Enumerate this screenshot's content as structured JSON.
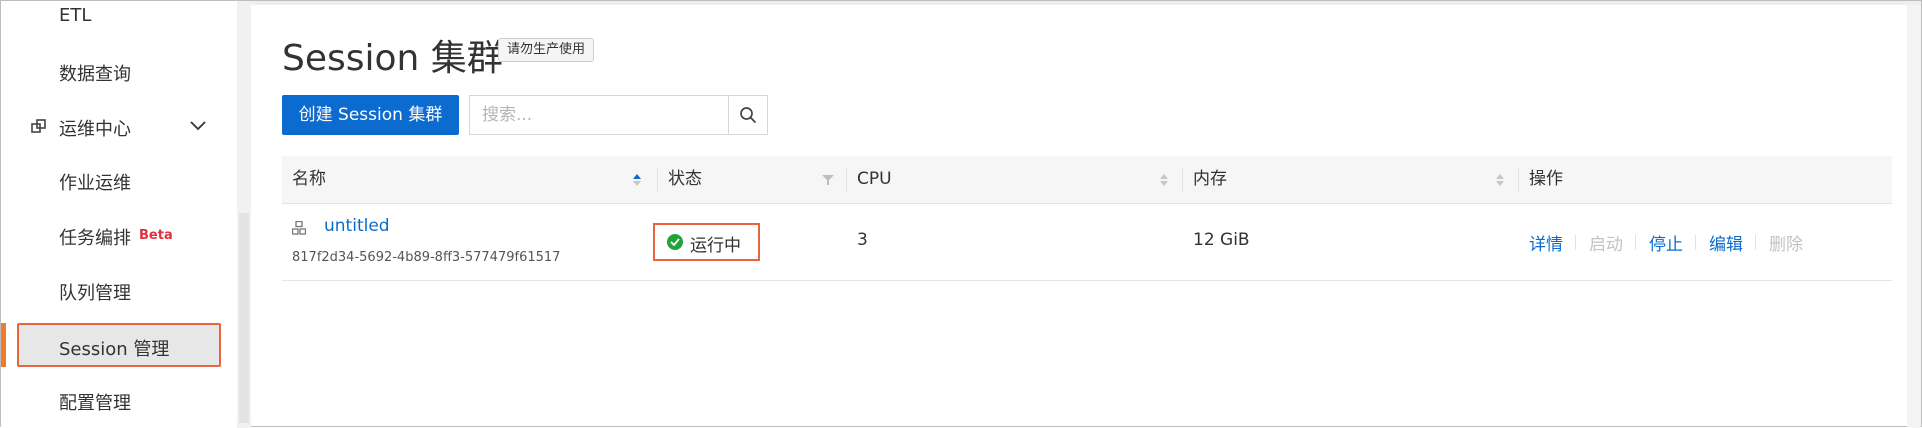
{
  "sidebar": {
    "items": [
      {
        "label": "ETL"
      },
      {
        "label": "数据查询"
      },
      {
        "label": "运维中心"
      },
      {
        "label": "作业运维"
      },
      {
        "label": "任务编排",
        "badge": "Beta"
      },
      {
        "label": "队列管理"
      },
      {
        "label": "Session 管理"
      },
      {
        "label": "配置管理"
      }
    ]
  },
  "header": {
    "title": "Session 集群",
    "tag": "请勿生产使用"
  },
  "toolbar": {
    "create_label": "创建 Session 集群",
    "search_placeholder": "搜索..."
  },
  "table": {
    "columns": [
      "名称",
      "状态",
      "CPU",
      "内存",
      "操作"
    ],
    "rows": [
      {
        "name": "untitled",
        "id": "817f2d34-5692-4b89-8ff3-577479f61517",
        "status": "运行中",
        "cpu": "3",
        "memory": "12 GiB",
        "actions": [
          "详情",
          "启动",
          "停止",
          "编辑",
          "删除"
        ]
      }
    ]
  },
  "colors": {
    "primary": "#0b6bcf",
    "highlight": "#e8643c",
    "running": "#22a33a",
    "beta": "#e0303a",
    "disabled": "#c3c3c3"
  }
}
